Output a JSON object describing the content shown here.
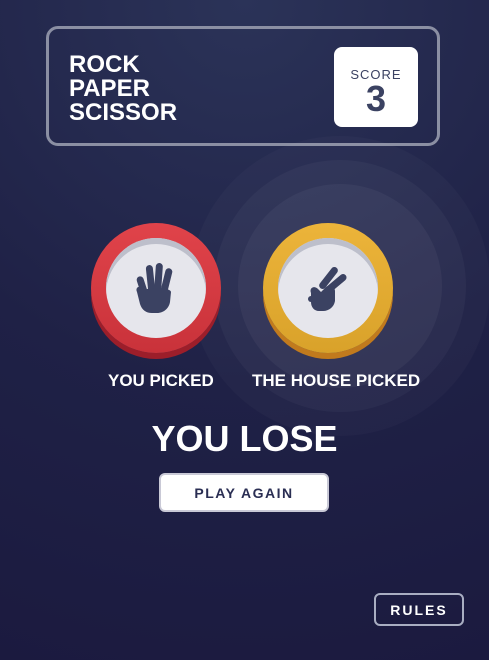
{
  "header": {
    "title_lines": [
      "ROCK",
      "PAPER",
      "SCISSOR"
    ],
    "score_label": "SCORE",
    "score_value": "3"
  },
  "game": {
    "player_pick": {
      "choice": "paper",
      "icon": "paper-hand-icon",
      "ring_color": "#d6353d",
      "label": "YOU PICKED"
    },
    "house_pick": {
      "choice": "scissors",
      "icon": "scissors-hand-icon",
      "ring_color": "#e2ab33",
      "label": "THE HOUSE PICKED",
      "winner_highlight": true
    },
    "result_text": "YOU LOSE",
    "play_again_label": "PLAY AGAIN"
  },
  "footer": {
    "rules_label": "RULES"
  },
  "colors": {
    "background": "#1f2146",
    "header_border": "#8b8fa3",
    "score_text": "#3b4262",
    "icon": "#3b4262",
    "button_text": "#2a2e53"
  }
}
